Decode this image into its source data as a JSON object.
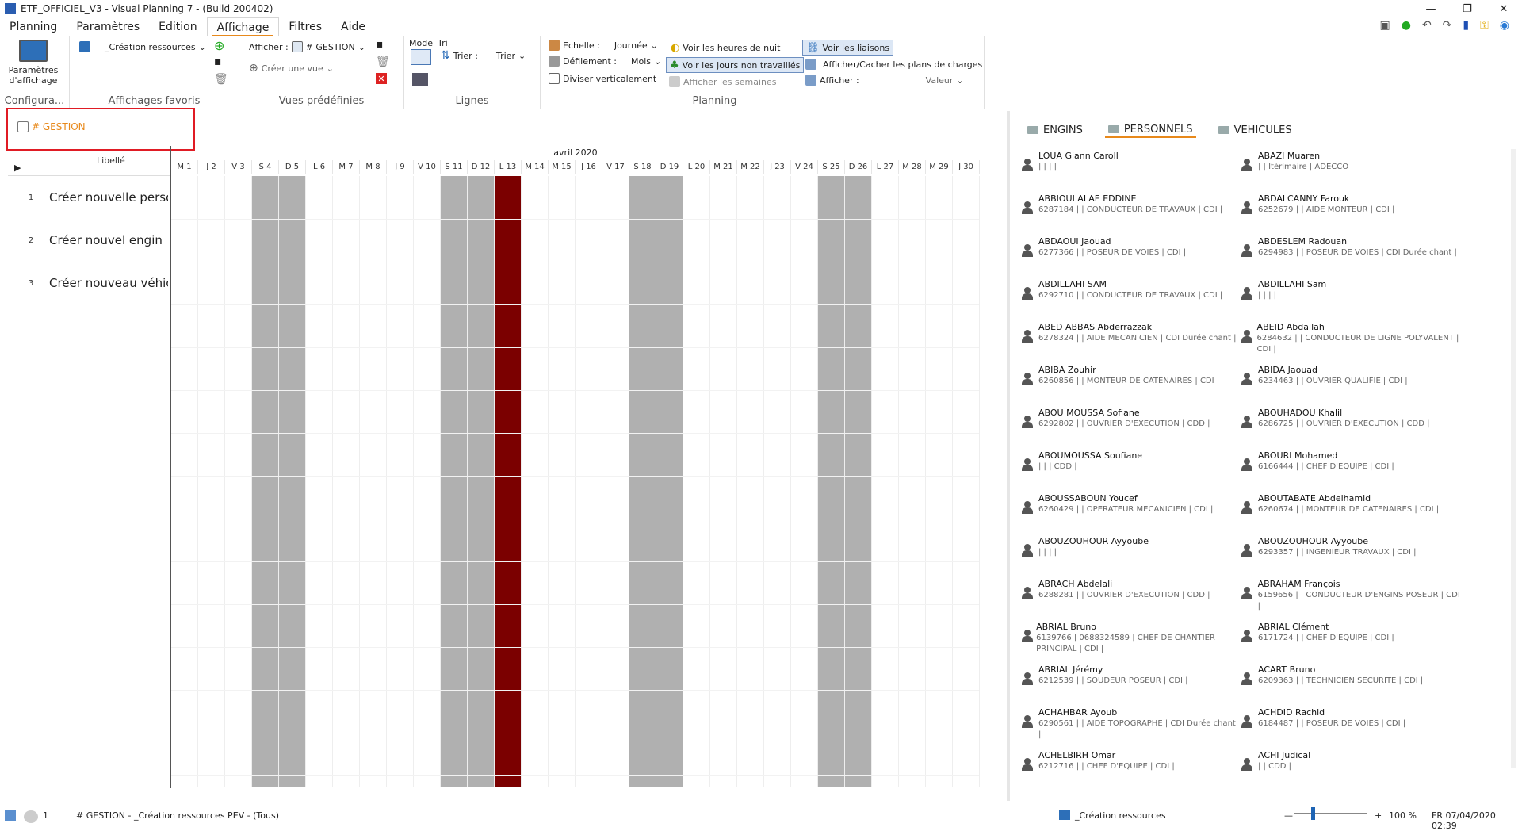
{
  "window": {
    "title": "ETF_OFFICIEL_V3 - Visual Planning 7 - (Build 200402)",
    "min": "—",
    "max": "❐",
    "close": "✕"
  },
  "menu": [
    "Planning",
    "Paramètres",
    "Edition",
    "Affichage",
    "Filtres",
    "Aide"
  ],
  "ribbon": {
    "config": {
      "button": "Paramètres d'affichage",
      "label": "Configura..."
    },
    "favoris": {
      "combo": "_Création ressources",
      "label": "Affichages favoris"
    },
    "vues": {
      "afficher": "Afficher :",
      "combo": "# GESTION",
      "create": "Créer une vue",
      "label": "Vues prédéfinies"
    },
    "lignes": {
      "mode": "Mode",
      "tri": "Tri",
      "trier": "Trier :",
      "trier_combo": "Trier",
      "label": "Lignes"
    },
    "planning": {
      "echelle": "Echelle :",
      "echelle_val": "Journée",
      "defil": "Défilement :",
      "defil_val": "Mois",
      "diviser": "Diviser verticalement",
      "nuit": "Voir les heures de nuit",
      "jours": "Voir les jours non travaillés",
      "semaines": "Afficher les semaines",
      "liaisons": "Voir les liaisons",
      "plans": "Afficher/Cacher les plans de charges",
      "afficher": "Afficher :",
      "valeur": "Valeur",
      "label": "Planning"
    }
  },
  "view": {
    "tab": "# GESTION",
    "libelle": "Libellé",
    "month": "avril 2020",
    "days": [
      "M 1",
      "J 2",
      "V 3",
      "S 4",
      "D 5",
      "L 6",
      "M 7",
      "M 8",
      "J 9",
      "V 10",
      "S 11",
      "D 12",
      "L 13",
      "M 14",
      "M 15",
      "J 16",
      "V 17",
      "S 18",
      "D 19",
      "L 20",
      "M 21",
      "M 22",
      "J 23",
      "V 24",
      "S 25",
      "D 26",
      "L 27",
      "M 28",
      "M 29",
      "J 30"
    ],
    "weekend_idx": [
      3,
      4,
      10,
      11,
      17,
      18,
      24,
      25
    ],
    "today_idx": 12,
    "rows": [
      {
        "num": "1",
        "label": "Créer nouvelle personne"
      },
      {
        "num": "2",
        "label": "Créer nouvel engin"
      },
      {
        "num": "3",
        "label": "Créer nouveau véhicule"
      }
    ]
  },
  "resources": {
    "tabs": [
      "ENGINS",
      "PERSONNELS",
      "VEHICULES"
    ],
    "active": 1,
    "people": [
      {
        "name": "LOUA Giann Caroll",
        "detail": "| | | |"
      },
      {
        "name": "ABAZI Muaren",
        "detail": "| | Itérimaire | ADECCO"
      },
      {
        "name": "ABBIOUI ALAE EDDINE",
        "detail": "6287184 | | CONDUCTEUR DE TRAVAUX | CDI |"
      },
      {
        "name": "ABDALCANNY Farouk",
        "detail": "6252679 | | AIDE MONTEUR | CDI |"
      },
      {
        "name": "ABDAOUI Jaouad",
        "detail": "6277366 | | POSEUR DE VOIES | CDI |"
      },
      {
        "name": "ABDESLEM Radouan",
        "detail": "6294983 | | POSEUR DE VOIES | CDI Durée chant |"
      },
      {
        "name": "ABDILLAHI SAM",
        "detail": "6292710 | | CONDUCTEUR DE TRAVAUX | CDI |"
      },
      {
        "name": "ABDILLAHI Sam",
        "detail": "| | | |"
      },
      {
        "name": "ABED ABBAS Abderrazzak",
        "detail": "6278324 | | AIDE MECANICIEN | CDI Durée chant |"
      },
      {
        "name": "ABEID Abdallah",
        "detail": "6284632 | | CONDUCTEUR DE LIGNE POLYVALENT | CDI |"
      },
      {
        "name": "ABIBA Zouhir",
        "detail": "6260856 | | MONTEUR DE CATENAIRES | CDI |"
      },
      {
        "name": "ABIDA Jaouad",
        "detail": "6234463 | | OUVRIER QUALIFIE | CDI |"
      },
      {
        "name": "ABOU MOUSSA Sofiane",
        "detail": "6292802 | | OUVRIER D'EXECUTION | CDD |"
      },
      {
        "name": "ABOUHADOU Khalil",
        "detail": "6286725 | | OUVRIER D'EXECUTION | CDD |"
      },
      {
        "name": "ABOUMOUSSA Soufiane",
        "detail": "| | | CDD |"
      },
      {
        "name": "ABOURI Mohamed",
        "detail": "6166444 | | CHEF D'EQUIPE | CDI |"
      },
      {
        "name": "ABOUSSABOUN Youcef",
        "detail": "6260429 | | OPERATEUR MECANICIEN | CDI |"
      },
      {
        "name": "ABOUTABATE Abdelhamid",
        "detail": "6260674 | | MONTEUR DE CATENAIRES | CDI |"
      },
      {
        "name": "ABOUZOUHOUR Ayyoube",
        "detail": "| | | |"
      },
      {
        "name": "ABOUZOUHOUR Ayyoube",
        "detail": "6293357 | | INGENIEUR TRAVAUX | CDI |"
      },
      {
        "name": "ABRACH Abdelali",
        "detail": "6288281 | | OUVRIER D'EXECUTION | CDD |"
      },
      {
        "name": "ABRAHAM François",
        "detail": "6159656 | | CONDUCTEUR D'ENGINS POSEUR | CDI |"
      },
      {
        "name": "ABRIAL Bruno",
        "detail": "6139766 | 0688324589 | CHEF DE CHANTIER PRINCIPAL | CDI |"
      },
      {
        "name": "ABRIAL Clément",
        "detail": "6171724 | | CHEF D'EQUIPE | CDI |"
      },
      {
        "name": "ABRIAL Jérémy",
        "detail": "6212539 | | SOUDEUR POSEUR | CDI |"
      },
      {
        "name": "ACART Bruno",
        "detail": "6209363 | | TECHNICIEN SECURITE | CDI |"
      },
      {
        "name": "ACHAHBAR Ayoub",
        "detail": "6290561 | | AIDE TOPOGRAPHE | CDI Durée chant |"
      },
      {
        "name": "ACHDID Rachid",
        "detail": "6184487 | | POSEUR DE VOIES | CDI |"
      },
      {
        "name": "ACHELBIRH Omar",
        "detail": "6212716 | | CHEF D'EQUIPE | CDI |"
      },
      {
        "name": "ACHI Judical",
        "detail": "| | CDD |"
      }
    ]
  },
  "status": {
    "count": "1",
    "view": "# GESTION - _Création ressources PEV - (Tous)",
    "fav": "_Création ressources",
    "zoom": "100 %",
    "date": "FR 07/04/2020 02:39"
  }
}
